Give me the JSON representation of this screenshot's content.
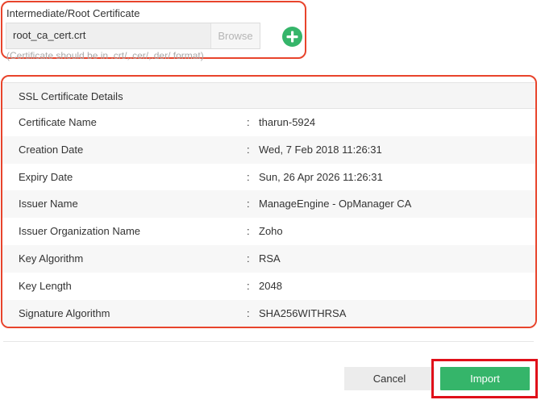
{
  "certificate_upload": {
    "label": "Intermediate/Root Certificate",
    "file_name": "root_ca_cert.crt",
    "browse_label": "Browse",
    "add_icon": "plus-circle-icon",
    "hint": "(Certificate should be in .crt/,.cer/,.der/ format)"
  },
  "ssl_details": {
    "title": "SSL Certificate Details",
    "separator": ":",
    "rows": [
      {
        "label": "Certificate Name",
        "value": "tharun-5924"
      },
      {
        "label": "Creation Date",
        "value": "Wed, 7 Feb 2018 11:26:31"
      },
      {
        "label": "Expiry Date",
        "value": "Sun, 26 Apr 2026 11:26:31"
      },
      {
        "label": "Issuer Name",
        "value": "ManageEngine - OpManager CA"
      },
      {
        "label": "Issuer Organization Name",
        "value": "Zoho"
      },
      {
        "label": "Key Algorithm",
        "value": "RSA"
      },
      {
        "label": "Key Length",
        "value": "2048"
      },
      {
        "label": "Signature Algorithm",
        "value": "SHA256WITHRSA"
      }
    ]
  },
  "footer": {
    "cancel_label": "Cancel",
    "import_label": "Import"
  },
  "colors": {
    "accent_green": "#35b56a",
    "highlight_red": "#e8442c",
    "focus_red": "#e0101a"
  }
}
